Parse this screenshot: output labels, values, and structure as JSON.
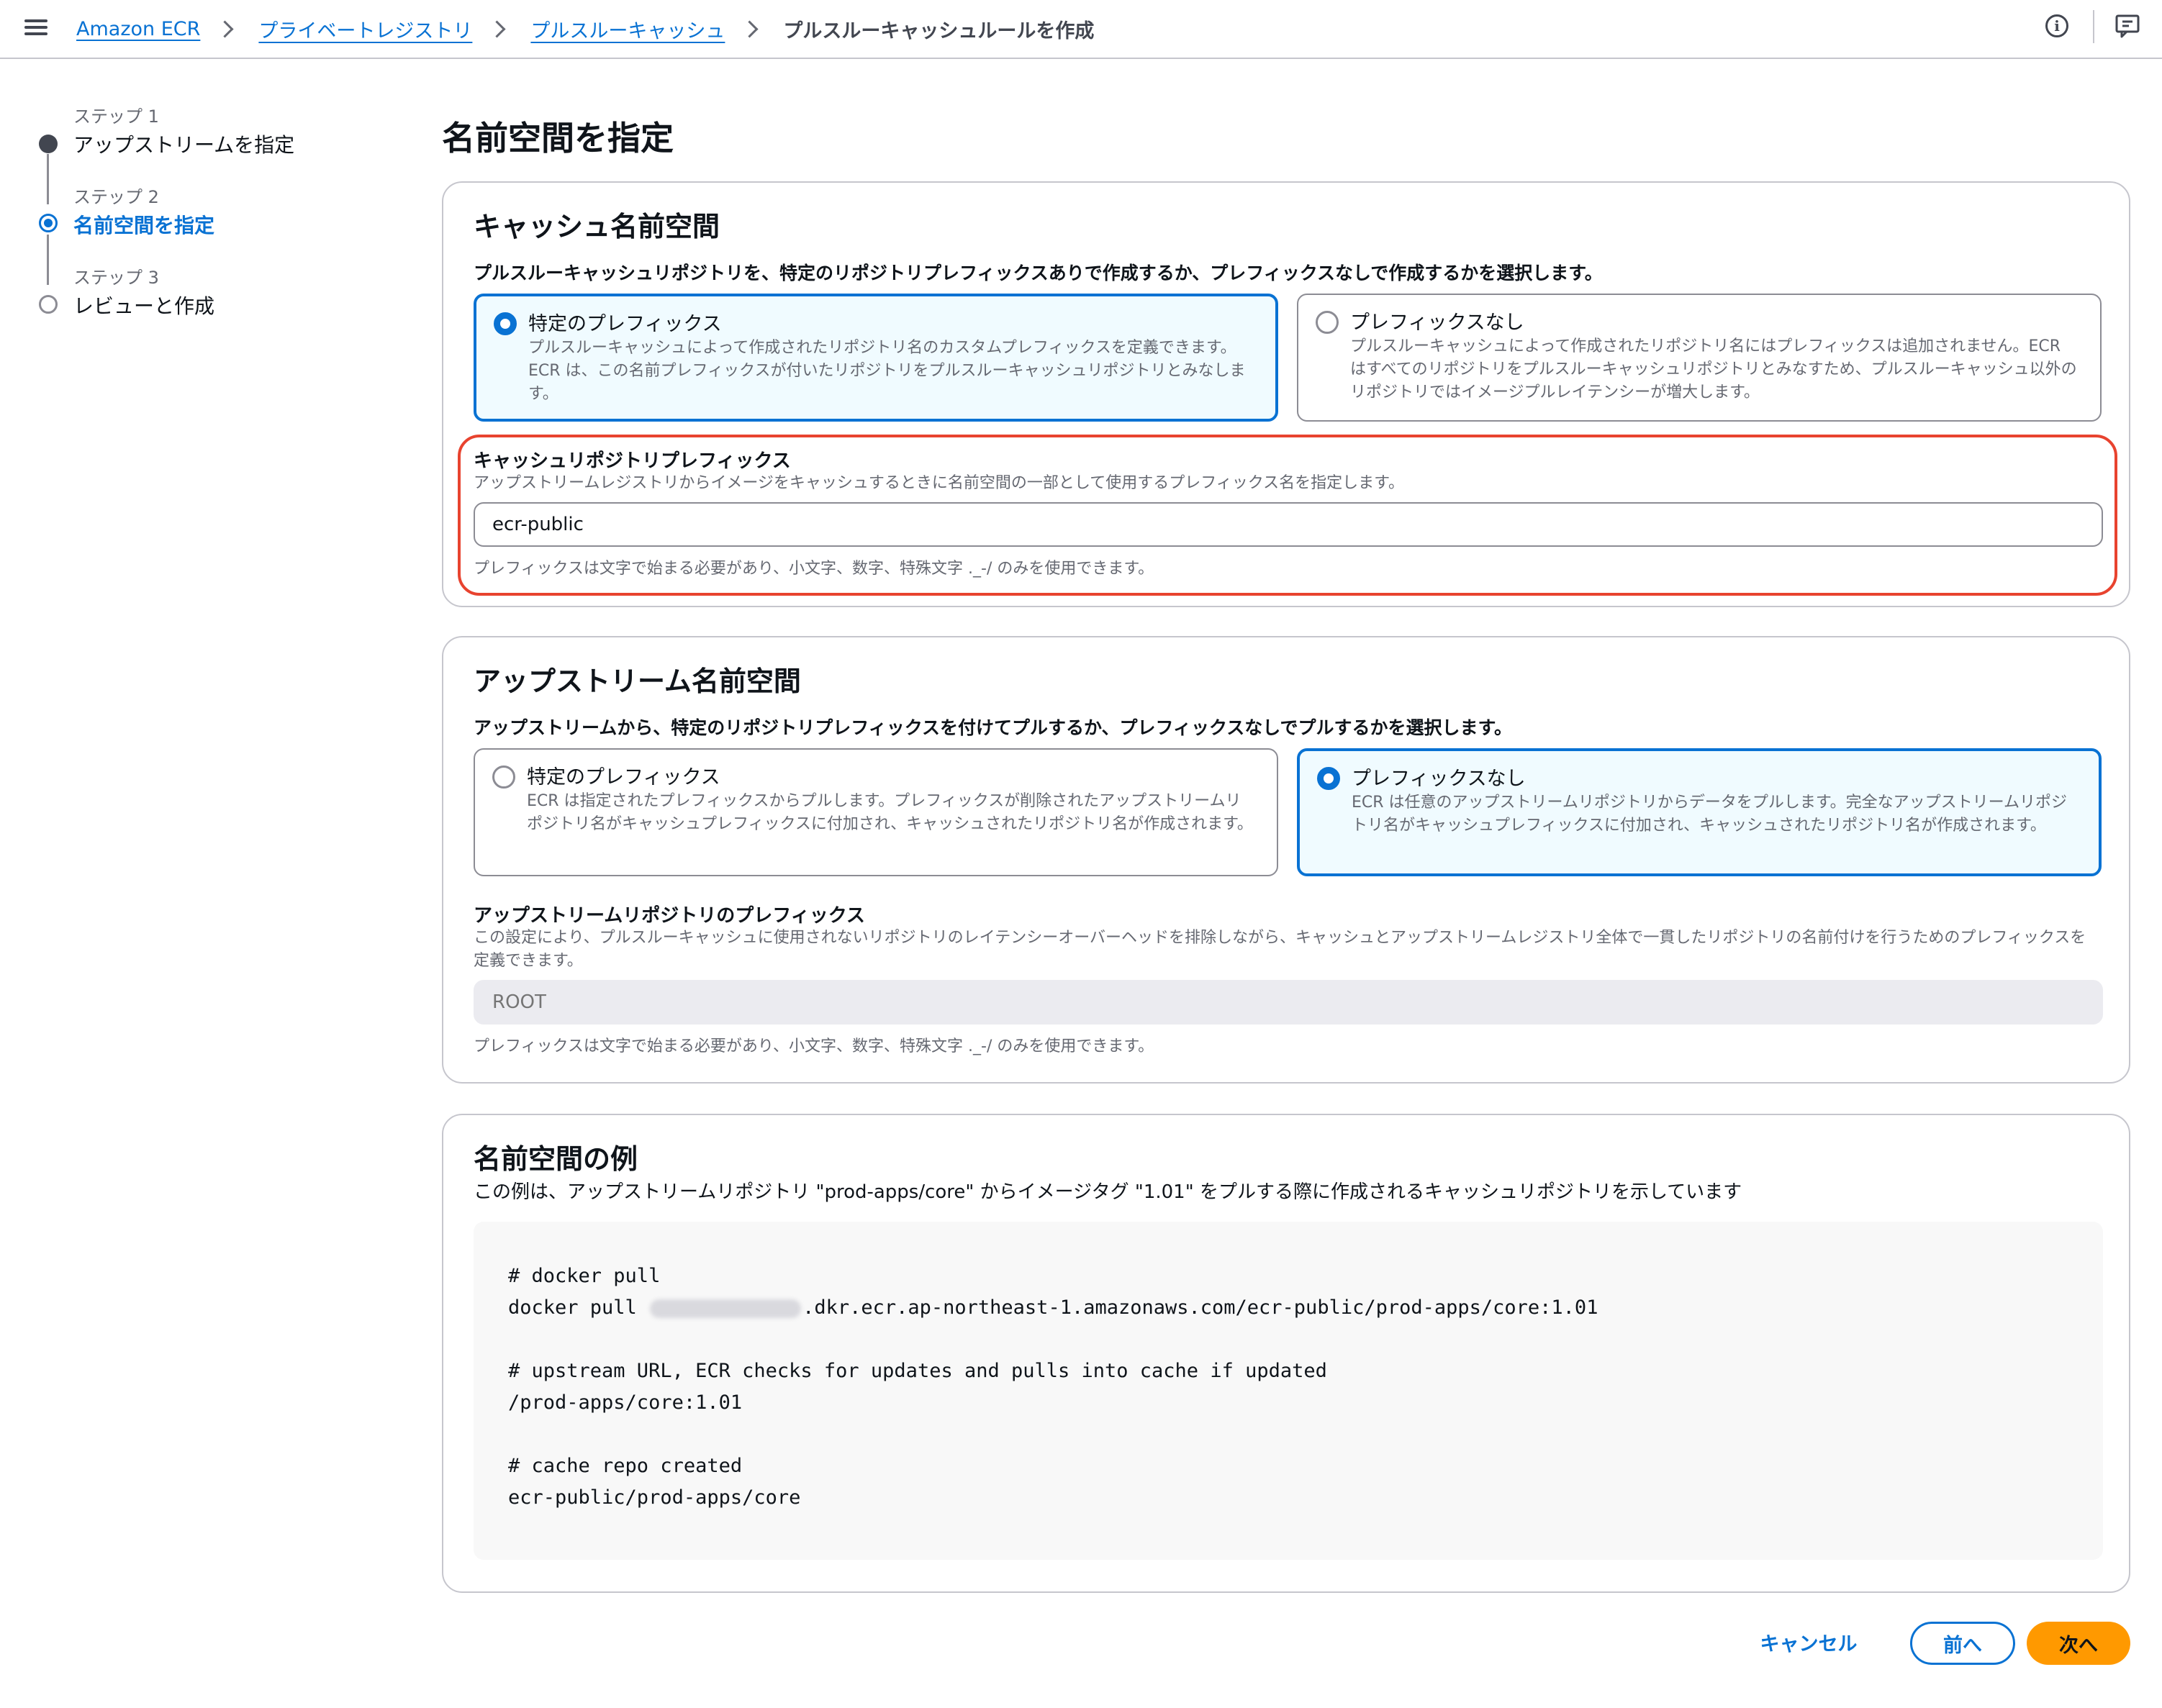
{
  "breadcrumb": {
    "items": [
      "Amazon ECR",
      "プライベートレジストリ",
      "プルスルーキャッシュ"
    ],
    "current": "プルスルーキャッシュルールを作成"
  },
  "steps": [
    {
      "label": "ステップ 1",
      "title": "アップストリームを指定",
      "state": "done"
    },
    {
      "label": "ステップ 2",
      "title": "名前空間を指定",
      "state": "active"
    },
    {
      "label": "ステップ 3",
      "title": "レビューと作成",
      "state": "todo"
    }
  ],
  "page_title": "名前空間を指定",
  "cache_namespace": {
    "title": "キャッシュ名前空間",
    "description": "プルスルーキャッシュリポジトリを、特定のリポジトリプレフィックスありで作成するか、プレフィックスなしで作成するかを選択します。",
    "options": [
      {
        "title": "特定のプレフィックス",
        "text": "プルスルーキャッシュによって作成されたリポジトリ名のカスタムプレフィックスを定義できます。ECR は、この名前プレフィックスが付いたリポジトリをプルスルーキャッシュリポジトリとみなします。",
        "selected": true
      },
      {
        "title": "プレフィックスなし",
        "text": "プルスルーキャッシュによって作成されたリポジトリ名にはプレフィックスは追加されません。ECR はすべてのリポジトリをプルスルーキャッシュリポジトリとみなすため、プルスルーキャッシュ以外のリポジトリではイメージプルレイテンシーが増大します。",
        "selected": false
      }
    ],
    "prefix_field": {
      "label": "キャッシュリポジトリプレフィックス",
      "description": "アップストリームレジストリからイメージをキャッシュするときに名前空間の一部として使用するプレフィックス名を指定します。",
      "value": "ecr-public",
      "hint": "プレフィックスは文字で始まる必要があり、小文字、数字、特殊文字 ._-/ のみを使用できます。"
    }
  },
  "upstream_namespace": {
    "title": "アップストリーム名前空間",
    "description": "アップストリームから、特定のリポジトリプレフィックスを付けてプルするか、プレフィックスなしでプルするかを選択します。",
    "options": [
      {
        "title": "特定のプレフィックス",
        "text": "ECR は指定されたプレフィックスからプルします。プレフィックスが削除されたアップストリームリポジトリ名がキャッシュプレフィックスに付加され、キャッシュされたリポジトリ名が作成されます。",
        "selected": false
      },
      {
        "title": "プレフィックスなし",
        "text": "ECR は任意のアップストリームリポジトリからデータをプルします。完全なアップストリームリポジトリ名がキャッシュプレフィックスに付加され、キャッシュされたリポジトリ名が作成されます。",
        "selected": true
      }
    ],
    "prefix_field": {
      "label": "アップストリームリポジトリのプレフィックス",
      "description": "この設定により、プルスルーキャッシュに使用されないリポジトリのレイテンシーオーバーヘッドを排除しながら、キャッシュとアップストリームレジストリ全体で一貫したリポジトリの名前付けを行うためのプレフィックスを定義できます。",
      "placeholder": "ROOT",
      "hint": "プレフィックスは文字で始まる必要があり、小文字、数字、特殊文字 ._-/ のみを使用できます。"
    }
  },
  "example": {
    "title": "名前空間の例",
    "description": "この例は、アップストリームリポジトリ \"prod-apps/core\" からイメージタグ \"1.01\" をプルする際に作成されるキャッシュリポジトリを示しています",
    "code": {
      "comment1": "# docker pull",
      "pull_prefix": "docker pull ",
      "pull_suffix": ".dkr.ecr.ap-northeast-1.amazonaws.com/ecr-public/prod-apps/core:1.01",
      "comment2": "# upstream URL, ECR checks for updates and pulls into cache if updated",
      "upstream": "/prod-apps/core:1.01",
      "comment3": "# cache repo created",
      "cache_repo": "ecr-public/prod-apps/core"
    }
  },
  "footer": {
    "cancel": "キャンセル",
    "previous": "前へ",
    "next": "次へ"
  },
  "colors": {
    "link": "#0972d3",
    "primary_button": "#ff9900",
    "highlight": "#e8432f"
  }
}
